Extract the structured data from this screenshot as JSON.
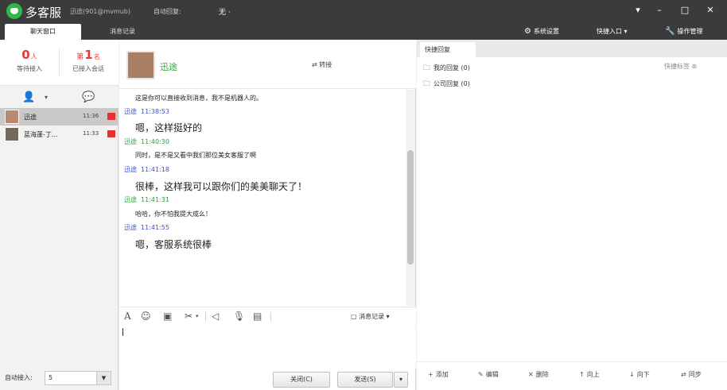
{
  "titlebar": {
    "app_name": "多客服",
    "status": "迅途(901@mvmub)",
    "auto_join_label": "自动回复:",
    "auto_join_value": "无 ·"
  },
  "tabs": {
    "chat": "聊天窗口",
    "history": "消息记录"
  },
  "toolbar": {
    "settings": "系统设置",
    "shortcuts": "快捷入口",
    "manage": "操作管理"
  },
  "stats": {
    "waiting_num": "0",
    "waiting_unit": "人",
    "waiting_label": "等待接入",
    "accepted_prefix": "第",
    "accepted_num": "1",
    "accepted_unit": "名",
    "accepted_label": "已接入会话"
  },
  "sessions": [
    {
      "name": "迅途",
      "time": "11:36"
    },
    {
      "name": "蓝海蓬-丁...",
      "time": "11:33"
    }
  ],
  "auto_join": {
    "label": "自动接入:",
    "value": "5"
  },
  "chat": {
    "contact_name": "迅途",
    "transfer": "转接",
    "messages": [
      {
        "who": "",
        "time": "",
        "text": "这是你可以直接收到消息，我不是机器人的。",
        "side": "customer"
      },
      {
        "who": "迅途",
        "time": "11:38:53",
        "text": "嗯，这样挺好的",
        "side": "agent"
      },
      {
        "who": "迅途",
        "time": "11:40:30",
        "text": "同时，是不是又看中我们那位美女客服了啊",
        "side": "customer"
      },
      {
        "who": "迅途",
        "time": "11:41:18",
        "text": "很棒，这样我可以跟你们的美美聊天了！",
        "side": "agent"
      },
      {
        "who": "迅途",
        "time": "11:41:31",
        "text": "哈哈，你不怕我提大成么！",
        "side": "customer"
      },
      {
        "who": "迅途",
        "time": "11:41:55",
        "text": "嗯，客服系统很棒",
        "side": "agent"
      }
    ],
    "history_btn": "消息记录",
    "close_btn": "关闭(C)",
    "send_btn": "发送(S)"
  },
  "quick_reply": {
    "tab": "快捷回复",
    "folders": [
      "我的回复 (0)",
      "公司回复 (0)"
    ],
    "label": "快捷标签",
    "footer": [
      "添加",
      "编辑",
      "删除",
      "向上",
      "向下",
      "同步"
    ]
  },
  "colors": {
    "titlebar": "#3b3b3b",
    "accent_green": "#2fb84a",
    "badge_red": "#e63a3a",
    "agent_blue": "#3b4fd6"
  }
}
